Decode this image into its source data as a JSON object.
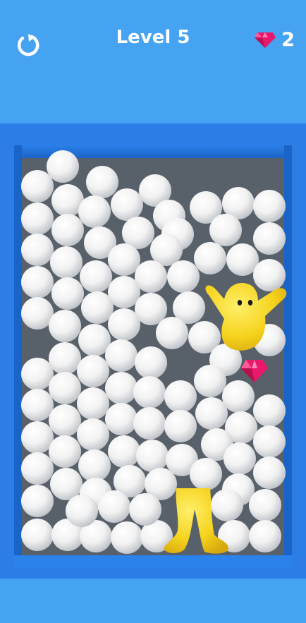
{
  "hud": {
    "level_text": "Level 5",
    "gem_count": "2",
    "restart_icon": "restart-icon",
    "gem_icon": "gem-icon"
  },
  "colors": {
    "background": "#45a3f2",
    "board_frame": "#2c7ee6",
    "board_floor": "#58606a",
    "ball": "#f4f4f4",
    "character": "#f5d21c",
    "gem": "#e8196a"
  }
}
